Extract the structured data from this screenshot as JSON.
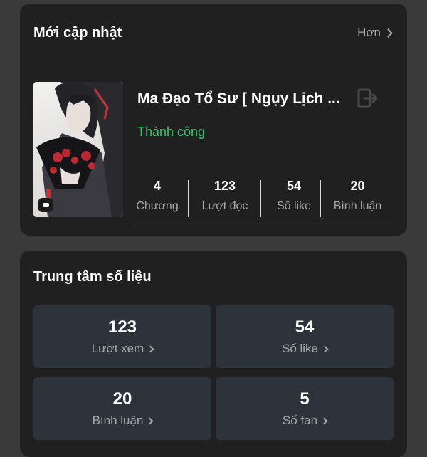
{
  "colors": {
    "page_background": "#3a3a3a",
    "card_background": "#202020",
    "tile_background": "#2d333a",
    "status_success": "#34c46a",
    "muted_text": "#a9a9a9"
  },
  "recent": {
    "title": "Mới cập nhật",
    "more_label": "Hơn",
    "book": {
      "title": "Ma Đạo Tổ Sư [ Ngụy Lịch ...",
      "status": "Thành công",
      "cover_icon": "chat-bubble-icon",
      "action_icon": "exit-icon",
      "metrics": [
        {
          "value": "4",
          "label": "Chương"
        },
        {
          "value": "123",
          "label": "Lượt đọc"
        },
        {
          "value": "54",
          "label": "Số like"
        },
        {
          "value": "20",
          "label": "Bình luận"
        }
      ]
    }
  },
  "stats": {
    "title": "Trung tâm số liệu",
    "tiles": [
      {
        "value": "123",
        "label": "Lượt xem"
      },
      {
        "value": "54",
        "label": "Số like"
      },
      {
        "value": "20",
        "label": "Bình luận"
      },
      {
        "value": "5",
        "label": "Số fan"
      }
    ]
  }
}
